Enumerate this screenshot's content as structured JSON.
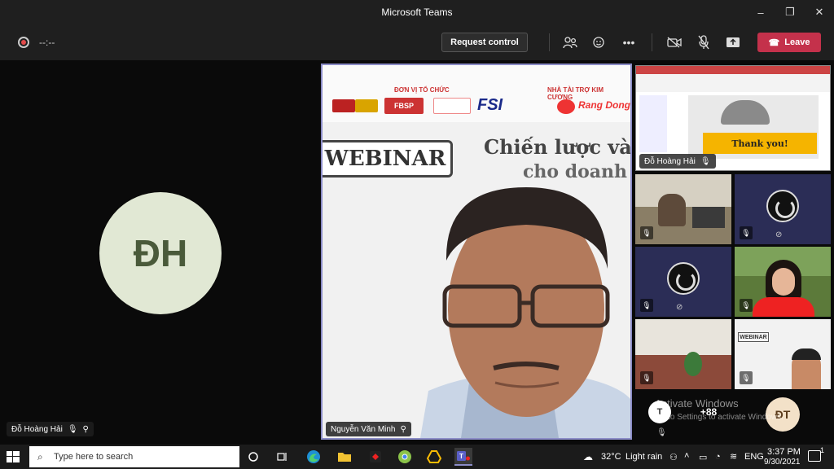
{
  "window": {
    "title": "Microsoft Teams",
    "controls": [
      "–",
      "❐",
      "✕"
    ]
  },
  "callbar": {
    "timer": "--:--",
    "request_control_label": "Request control",
    "leave_label": "Leave",
    "leave_color": "#c4314b"
  },
  "left_participant": {
    "initials": "ĐH",
    "name": "Đỗ Hoàng Hải",
    "avatar_color": "#e1e8d4"
  },
  "main_video": {
    "participant_name": "Nguyễn Văn Minh",
    "slide": {
      "organizer_label": "ĐƠN VỊ TỔ CHỨC",
      "sponsor_label": "NHÀ TÀI TRỢ KIM CƯƠNG",
      "sponsor_name": "Rang Dong",
      "fsi_logo": "FSI",
      "fbsp_logo": "FBSP",
      "webinar_label": "WEBINAR",
      "title_line1": "Chiến lược và lộ",
      "title_line2": "cho doanh n"
    }
  },
  "shared_screen": {
    "presenter_name": "Đỗ Hoàng Hải",
    "slide_text": "Thank you!"
  },
  "overflow": {
    "count": "+88",
    "initial_t": "T",
    "initial_dt": "ĐT"
  },
  "activation": {
    "title": "Activate Windows",
    "subtitle": "Go to Settings to activate Windows."
  },
  "taskbar": {
    "search_placeholder": "Type here to search",
    "weather_temp": "32°C",
    "weather_desc": "Light rain",
    "language": "ENG",
    "time": "3:37 PM",
    "date": "9/30/2021",
    "notification_count": "1"
  }
}
